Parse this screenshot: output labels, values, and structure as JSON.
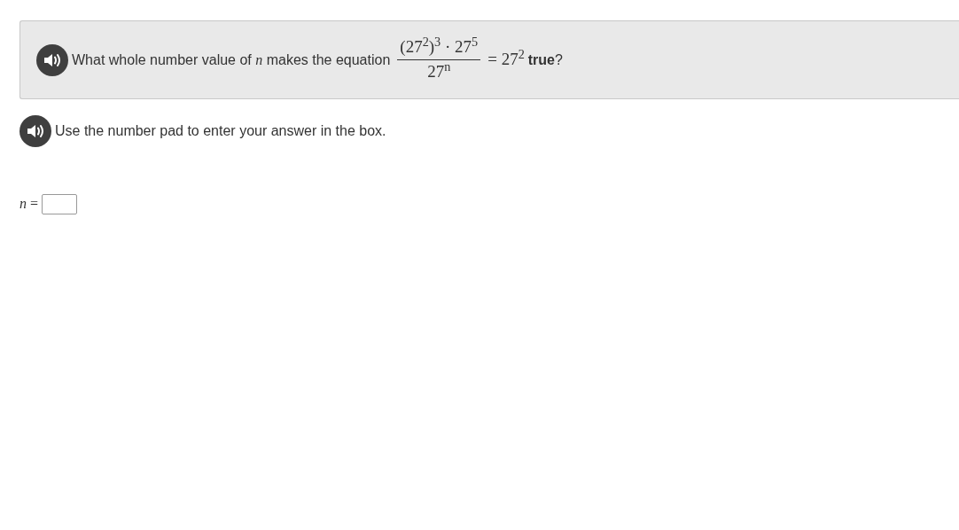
{
  "question": {
    "audio": true,
    "prefix": "What whole number value of *n* makes the equation",
    "fraction": {
      "numerator": "(27$^{2}$)$^{3}$ · 27$^{5}$",
      "denominator": "27$^{n}$"
    },
    "rhs": "= 27$^{2}$",
    "suffix": "**true**?"
  },
  "instruction": {
    "audio": true,
    "text": "Use the number pad to enter your answer in the box."
  },
  "answer": {
    "label": "*n* ="
  }
}
